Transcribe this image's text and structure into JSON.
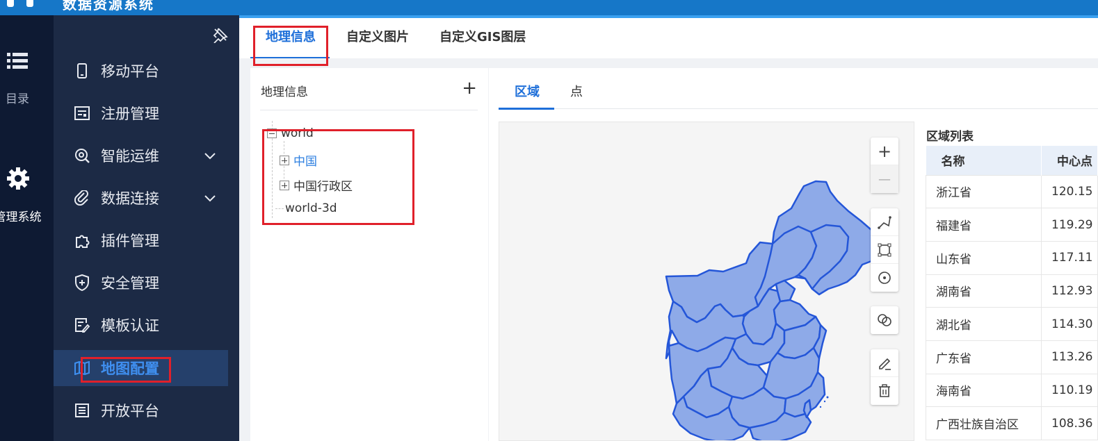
{
  "app": {
    "title": "数据资源系统"
  },
  "rail": {
    "items": [
      {
        "label": "目录",
        "icon": "list-icon"
      },
      {
        "label": "管理系统",
        "icon": "gear-icon"
      }
    ]
  },
  "sidebar": {
    "pin_icon": "pin-icon",
    "items": [
      {
        "label": "移动平台",
        "icon": "mobile-icon"
      },
      {
        "label": "注册管理",
        "icon": "register-icon"
      },
      {
        "label": "智能运维",
        "icon": "ops-icon",
        "expandable": true
      },
      {
        "label": "数据连接",
        "icon": "link-icon",
        "expandable": true
      },
      {
        "label": "插件管理",
        "icon": "puzzle-icon"
      },
      {
        "label": "安全管理",
        "icon": "shield-icon"
      },
      {
        "label": "模板认证",
        "icon": "template-icon"
      },
      {
        "label": "地图配置",
        "icon": "map-icon",
        "active": true
      },
      {
        "label": "开放平台",
        "icon": "open-icon"
      }
    ]
  },
  "tabs": [
    {
      "label": "地理信息",
      "active": true
    },
    {
      "label": "自定义图片"
    },
    {
      "label": "自定义GIS图层"
    }
  ],
  "geo_panel": {
    "title": "地理信息",
    "add_label": "+",
    "tree": [
      {
        "label": "world",
        "expanded": true
      },
      {
        "label": "中国",
        "selected": true
      },
      {
        "label": "中国行政区"
      },
      {
        "label": "world-3d"
      }
    ]
  },
  "map_panel": {
    "subtabs": [
      {
        "label": "区域",
        "active": true
      },
      {
        "label": "点"
      }
    ],
    "zoom_in": "+",
    "zoom_out": "—",
    "tools": [
      "polyline-icon",
      "rectangle-icon",
      "circle-icon",
      "merge-icon",
      "edit-icon",
      "delete-icon"
    ],
    "region_color": "#8eaae8",
    "region_border": "#2456d8"
  },
  "region_list": {
    "title": "区域列表",
    "columns": [
      "名称",
      "中心点"
    ],
    "rows": [
      [
        "浙江省",
        "120.15"
      ],
      [
        "福建省",
        "119.29"
      ],
      [
        "山东省",
        "117.11"
      ],
      [
        "湖南省",
        "112.93"
      ],
      [
        "湖北省",
        "114.30"
      ],
      [
        "广东省",
        "113.26"
      ],
      [
        "海南省",
        "110.19"
      ],
      [
        "广西壮族自治区",
        "108.36"
      ]
    ]
  },
  "colors": {
    "accent": "#1e6fd9",
    "sidebar_bg": "#1c2a45",
    "rail_bg": "#0e1a33",
    "topbar": "#1677c8",
    "highlight": "#e0202a"
  }
}
